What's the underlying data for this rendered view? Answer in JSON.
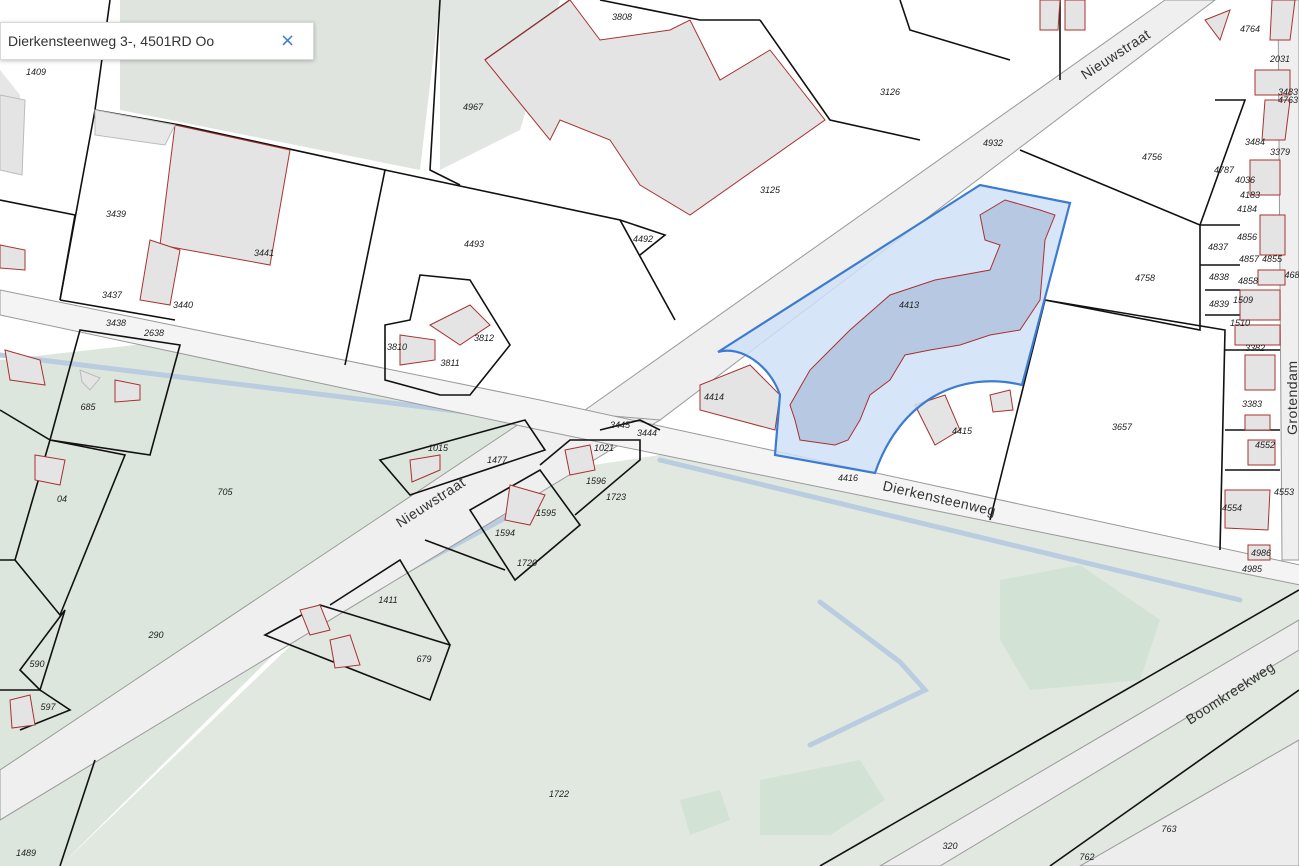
{
  "search": {
    "value": "Dierkensteenweg 3-, 4501RD Oo",
    "clear_icon": "close-icon",
    "clear_glyph": "×"
  },
  "colors": {
    "highlight_fill": "#cfe0f7",
    "highlight_stroke": "#3b7bd1",
    "building_stroke": "#a83232",
    "green_area": "#dfe7df",
    "road": "#f2f2f2"
  },
  "streets": [
    "Nieuwstraat",
    "Nieuwstraat",
    "Dierkensteenweg",
    "Grotendam",
    "Boomkreekweg"
  ],
  "selected_parcel": "4413",
  "parcels": [
    "3808",
    "4764",
    "2031",
    "3483",
    "4763",
    "1409",
    "4967",
    "3126",
    "4932",
    "4756",
    "3484",
    "3379",
    "4787",
    "4036",
    "4183",
    "4184",
    "3439",
    "3125",
    "4492",
    "4493",
    "4837",
    "4856",
    "4857",
    "4855",
    "4838",
    "4858",
    "3441",
    "4758",
    "468",
    "4839",
    "1509",
    "3437",
    "3440",
    "4413",
    "3438",
    "2638",
    "1510",
    "3810",
    "3812",
    "3811",
    "3382",
    "685",
    "4414",
    "3445",
    "3444",
    "4415",
    "3657",
    "3383",
    "1015",
    "1021",
    "4552",
    "1477",
    "1596",
    "4416",
    "1723",
    "4553",
    "705",
    "1595",
    "4554",
    "04",
    "1594",
    "4986",
    "1720",
    "4985",
    "1411",
    "290",
    "679",
    "590",
    "597",
    "1722",
    "320",
    "763",
    "1489",
    "762"
  ]
}
